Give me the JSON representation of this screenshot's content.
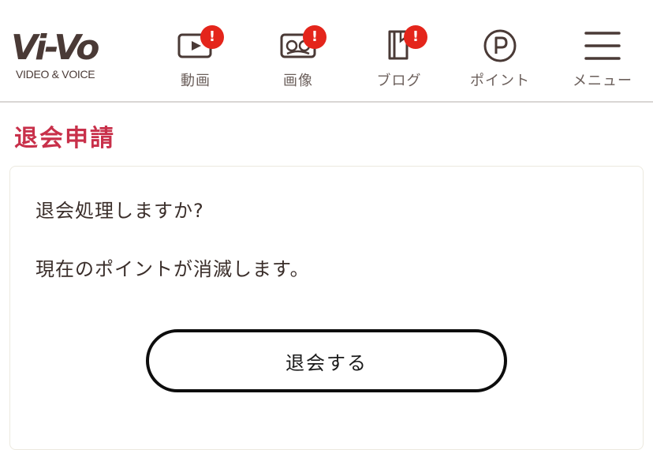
{
  "header": {
    "logo": {
      "mark": "Vi-Vo",
      "subtitle": "VIDEO & VOICE"
    },
    "nav": [
      {
        "label": "動画",
        "icon": "video-play-icon",
        "badge": "!"
      },
      {
        "label": "画像",
        "icon": "image-icon",
        "badge": "!"
      },
      {
        "label": "ブログ",
        "icon": "blog-book-icon",
        "badge": "!"
      },
      {
        "label": "ポイント",
        "icon": "point-p-icon"
      },
      {
        "label": "メニュー",
        "icon": "hamburger-menu-icon"
      }
    ]
  },
  "main": {
    "title": "退会申請",
    "message1": "退会処理しますか?",
    "message2": "現在のポイントが消滅します。",
    "confirm_button": "退会する"
  },
  "colors": {
    "title": "#c8304a",
    "badge": "#e4251b",
    "text": "#3a2e2a",
    "icon": "#4a3a36"
  }
}
